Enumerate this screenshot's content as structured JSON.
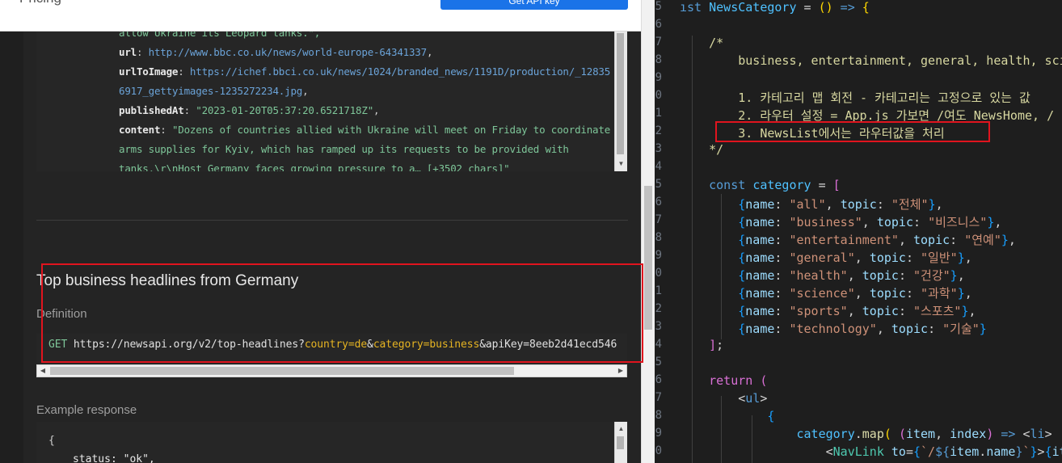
{
  "browser": {
    "header": {
      "nav_text": "Pricing",
      "cta_label": "Get API key"
    },
    "response1": {
      "lines": [
        {
          "parts": [
            {
              "t": "allow Ukraine its Leopard tanks.\",",
              "c": "str"
            }
          ]
        },
        {
          "parts": [
            {
              "t": "url",
              "c": "key"
            },
            {
              "t": ": ",
              "c": "punct"
            },
            {
              "t": "http://www.bbc.co.uk/news/world-europe-64341337",
              "c": "url"
            },
            {
              "t": ",",
              "c": "punct"
            }
          ]
        },
        {
          "parts": [
            {
              "t": "urlToImage",
              "c": "key"
            },
            {
              "t": ": ",
              "c": "punct"
            },
            {
              "t": "https://ichef.bbci.co.uk/news/1024/branded_news/1191D/production/_12835",
              "c": "url"
            }
          ]
        },
        {
          "parts": [
            {
              "t": "6917_gettyimages-1235272234.jpg",
              "c": "url"
            },
            {
              "t": ",",
              "c": "punct"
            }
          ]
        },
        {
          "parts": [
            {
              "t": "publishedAt",
              "c": "key"
            },
            {
              "t": ": ",
              "c": "punct"
            },
            {
              "t": "\"2023-01-20T05:37:20.6521718Z\"",
              "c": "str"
            },
            {
              "t": ",",
              "c": "punct"
            }
          ]
        },
        {
          "parts": [
            {
              "t": "content",
              "c": "key"
            },
            {
              "t": ": ",
              "c": "punct"
            },
            {
              "t": "\"Dozens of countries allied with Ukraine will meet on Friday to coordinate",
              "c": "str"
            }
          ]
        },
        {
          "parts": [
            {
              "t": "arms supplies for Kyiv, which has ramped up its requests to be provided with",
              "c": "str"
            }
          ]
        },
        {
          "parts": [
            {
              "t": "tanks.\\r\\nHost Germany faces growing pressure to a… [+3502 chars]\"",
              "c": "str"
            }
          ]
        }
      ]
    },
    "section": {
      "title": "Top business headlines from Germany",
      "definition_label": "Definition",
      "endpoint": {
        "method": "GET",
        "base": "https://newsapi.org/v2/top-headlines?",
        "param1": "country=de",
        "amp1": "&",
        "param2": "category=business",
        "rest": "&apiKey=8eeb2d41ecd546"
      },
      "example_label": "Example response",
      "response2_lines": [
        "{",
        "status: \"ok\","
      ]
    }
  },
  "editor": {
    "gutter": [
      "5",
      "6",
      "7",
      "8",
      "9",
      "0",
      "1",
      "2",
      "3",
      "4",
      "5",
      "6",
      "7",
      "8",
      "9",
      "0",
      "1",
      "2",
      "3",
      "4",
      "5",
      "6",
      "7",
      "8",
      "9",
      "0"
    ],
    "code_lines": [
      {
        "parts": [
          {
            "t": "ıst ",
            "c": "kw"
          },
          {
            "t": "NewsCategory",
            "c": "var"
          },
          {
            "t": " = ",
            "c": "pu"
          },
          {
            "t": "()",
            "c": "br1"
          },
          {
            "t": " => ",
            "c": "kw"
          },
          {
            "t": "{",
            "c": "br1"
          }
        ]
      },
      {
        "parts": []
      },
      {
        "parts": [
          {
            "t": "    /*",
            "c": "cm"
          }
        ]
      },
      {
        "parts": [
          {
            "t": "        business, entertainment, general, health, scie",
            "c": "cm"
          }
        ]
      },
      {
        "parts": []
      },
      {
        "parts": [
          {
            "t": "        1. 카테고리 맵 회전 - 카테고리는 고정으로 있는 값",
            "c": "cm"
          }
        ]
      },
      {
        "parts": [
          {
            "t": "        2. 라우터 설정 = App.js 가보면 /여도 NewsHome, /",
            "c": "cm"
          }
        ]
      },
      {
        "parts": [
          {
            "t": "        3. NewsList에서는 라우터값을 처리",
            "c": "cm"
          }
        ]
      },
      {
        "parts": [
          {
            "t": "    */",
            "c": "cm"
          }
        ]
      },
      {
        "parts": []
      },
      {
        "parts": [
          {
            "t": "    const ",
            "c": "kw"
          },
          {
            "t": "category",
            "c": "var"
          },
          {
            "t": " = ",
            "c": "pu"
          },
          {
            "t": "[",
            "c": "br2"
          }
        ]
      },
      {
        "parts": [
          {
            "t": "        {",
            "c": "br3"
          },
          {
            "t": "name",
            "c": "pr"
          },
          {
            "t": ": ",
            "c": "pu"
          },
          {
            "t": "\"all\"",
            "c": "st"
          },
          {
            "t": ", ",
            "c": "pu"
          },
          {
            "t": "topic",
            "c": "pr"
          },
          {
            "t": ": ",
            "c": "pu"
          },
          {
            "t": "\"전체\"",
            "c": "st"
          },
          {
            "t": "}",
            "c": "br3"
          },
          {
            "t": ",",
            "c": "pu"
          }
        ]
      },
      {
        "parts": [
          {
            "t": "        {",
            "c": "br3"
          },
          {
            "t": "name",
            "c": "pr"
          },
          {
            "t": ": ",
            "c": "pu"
          },
          {
            "t": "\"business\"",
            "c": "st"
          },
          {
            "t": ", ",
            "c": "pu"
          },
          {
            "t": "topic",
            "c": "pr"
          },
          {
            "t": ": ",
            "c": "pu"
          },
          {
            "t": "\"비즈니스\"",
            "c": "st"
          },
          {
            "t": "}",
            "c": "br3"
          },
          {
            "t": ",",
            "c": "pu"
          }
        ]
      },
      {
        "parts": [
          {
            "t": "        {",
            "c": "br3"
          },
          {
            "t": "name",
            "c": "pr"
          },
          {
            "t": ": ",
            "c": "pu"
          },
          {
            "t": "\"entertainment\"",
            "c": "st"
          },
          {
            "t": ", ",
            "c": "pu"
          },
          {
            "t": "topic",
            "c": "pr"
          },
          {
            "t": ": ",
            "c": "pu"
          },
          {
            "t": "\"연예\"",
            "c": "st"
          },
          {
            "t": "}",
            "c": "br3"
          },
          {
            "t": ",",
            "c": "pu"
          }
        ]
      },
      {
        "parts": [
          {
            "t": "        {",
            "c": "br3"
          },
          {
            "t": "name",
            "c": "pr"
          },
          {
            "t": ": ",
            "c": "pu"
          },
          {
            "t": "\"general\"",
            "c": "st"
          },
          {
            "t": ", ",
            "c": "pu"
          },
          {
            "t": "topic",
            "c": "pr"
          },
          {
            "t": ": ",
            "c": "pu"
          },
          {
            "t": "\"일반\"",
            "c": "st"
          },
          {
            "t": "}",
            "c": "br3"
          },
          {
            "t": ",",
            "c": "pu"
          }
        ]
      },
      {
        "parts": [
          {
            "t": "        {",
            "c": "br3"
          },
          {
            "t": "name",
            "c": "pr"
          },
          {
            "t": ": ",
            "c": "pu"
          },
          {
            "t": "\"health\"",
            "c": "st"
          },
          {
            "t": ", ",
            "c": "pu"
          },
          {
            "t": "topic",
            "c": "pr"
          },
          {
            "t": ": ",
            "c": "pu"
          },
          {
            "t": "\"건강\"",
            "c": "st"
          },
          {
            "t": "}",
            "c": "br3"
          },
          {
            "t": ",",
            "c": "pu"
          }
        ]
      },
      {
        "parts": [
          {
            "t": "        {",
            "c": "br3"
          },
          {
            "t": "name",
            "c": "pr"
          },
          {
            "t": ": ",
            "c": "pu"
          },
          {
            "t": "\"science\"",
            "c": "st"
          },
          {
            "t": ", ",
            "c": "pu"
          },
          {
            "t": "topic",
            "c": "pr"
          },
          {
            "t": ": ",
            "c": "pu"
          },
          {
            "t": "\"과학\"",
            "c": "st"
          },
          {
            "t": "}",
            "c": "br3"
          },
          {
            "t": ",",
            "c": "pu"
          }
        ]
      },
      {
        "parts": [
          {
            "t": "        {",
            "c": "br3"
          },
          {
            "t": "name",
            "c": "pr"
          },
          {
            "t": ": ",
            "c": "pu"
          },
          {
            "t": "\"sports\"",
            "c": "st"
          },
          {
            "t": ", ",
            "c": "pu"
          },
          {
            "t": "topic",
            "c": "pr"
          },
          {
            "t": ": ",
            "c": "pu"
          },
          {
            "t": "\"스포츠\"",
            "c": "st"
          },
          {
            "t": "}",
            "c": "br3"
          },
          {
            "t": ",",
            "c": "pu"
          }
        ]
      },
      {
        "parts": [
          {
            "t": "        {",
            "c": "br3"
          },
          {
            "t": "name",
            "c": "pr"
          },
          {
            "t": ": ",
            "c": "pu"
          },
          {
            "t": "\"technology\"",
            "c": "st"
          },
          {
            "t": ", ",
            "c": "pu"
          },
          {
            "t": "topic",
            "c": "pr"
          },
          {
            "t": ": ",
            "c": "pu"
          },
          {
            "t": "\"기술\"",
            "c": "st"
          },
          {
            "t": "}",
            "c": "br3"
          }
        ]
      },
      {
        "parts": [
          {
            "t": "    ]",
            "c": "br2"
          },
          {
            "t": ";",
            "c": "pu"
          }
        ]
      },
      {
        "parts": []
      },
      {
        "parts": [
          {
            "t": "    return ",
            "c": "br2"
          },
          {
            "t": "(",
            "c": "br2"
          }
        ]
      },
      {
        "parts": [
          {
            "t": "        <",
            "c": "pu"
          },
          {
            "t": "ul",
            "c": "jsxtag"
          },
          {
            "t": ">",
            "c": "pu"
          }
        ]
      },
      {
        "parts": [
          {
            "t": "            {",
            "c": "br3"
          }
        ]
      },
      {
        "parts": [
          {
            "t": "                ",
            "c": "pu"
          },
          {
            "t": "category",
            "c": "var"
          },
          {
            "t": ".",
            "c": "pu"
          },
          {
            "t": "map",
            "c": "fn"
          },
          {
            "t": "( ",
            "c": "br1"
          },
          {
            "t": "(",
            "c": "br2"
          },
          {
            "t": "item",
            "c": "pr"
          },
          {
            "t": ", ",
            "c": "pu"
          },
          {
            "t": "index",
            "c": "pr"
          },
          {
            "t": ")",
            "c": "br2"
          },
          {
            "t": " => ",
            "c": "kw"
          },
          {
            "t": "<",
            "c": "pu"
          },
          {
            "t": "li",
            "c": "jsxtag"
          },
          {
            "t": ">",
            "c": "pu"
          }
        ]
      },
      {
        "parts": [
          {
            "t": "                    <",
            "c": "pu"
          },
          {
            "t": "NavLink",
            "c": "tg"
          },
          {
            "t": " ",
            "c": "pu"
          },
          {
            "t": "to",
            "c": "pr"
          },
          {
            "t": "=",
            "c": "pu"
          },
          {
            "t": "{",
            "c": "br3"
          },
          {
            "t": "`/",
            "c": "st"
          },
          {
            "t": "${",
            "c": "kw"
          },
          {
            "t": "item",
            "c": "pr"
          },
          {
            "t": ".",
            "c": "pu"
          },
          {
            "t": "name",
            "c": "pr"
          },
          {
            "t": "}",
            "c": "kw"
          },
          {
            "t": "`",
            "c": "st"
          },
          {
            "t": "}",
            "c": "br3"
          },
          {
            "t": ">",
            "c": "pu"
          },
          {
            "t": "{",
            "c": "br3"
          },
          {
            "t": "ite",
            "c": "pr"
          }
        ]
      }
    ]
  }
}
